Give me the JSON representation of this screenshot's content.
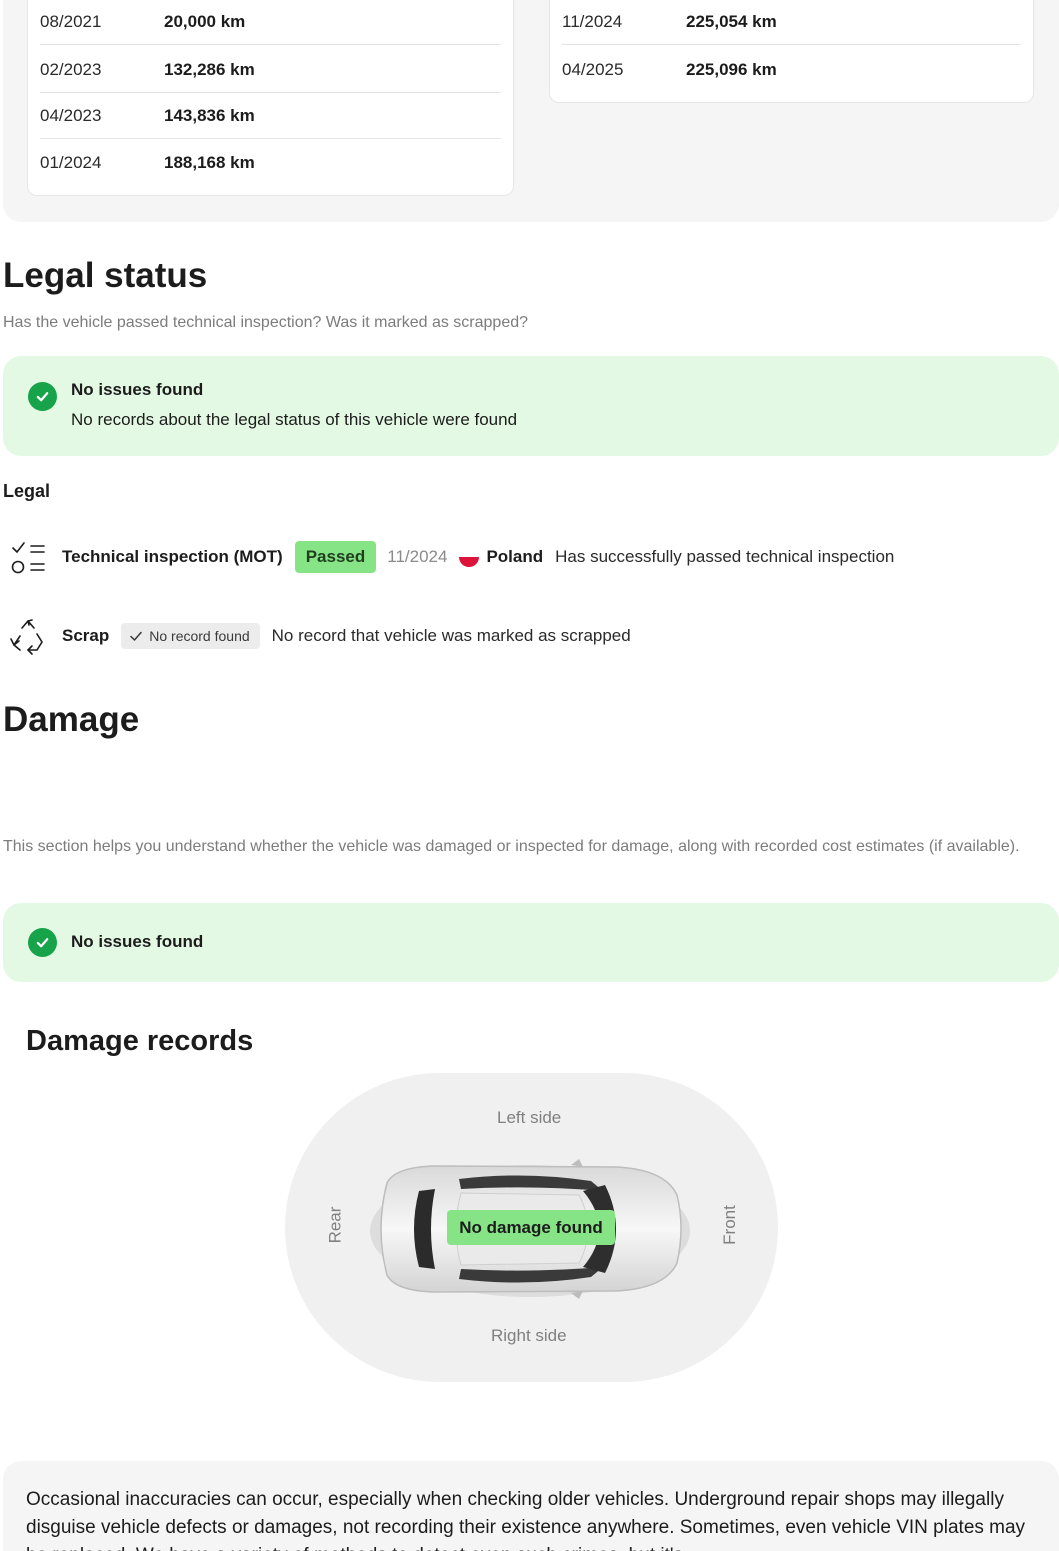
{
  "mileage": {
    "left_rows": [
      {
        "date": "08/2021",
        "km": "20,000 km"
      },
      {
        "date": "02/2023",
        "km": "132,286 km"
      },
      {
        "date": "04/2023",
        "km": "143,836 km"
      },
      {
        "date": "01/2024",
        "km": "188,168 km"
      }
    ],
    "right_rows": [
      {
        "date": "11/2024",
        "km": "225,054 km"
      },
      {
        "date": "04/2025",
        "km": "225,096 km"
      }
    ]
  },
  "legal_status": {
    "title": "Legal status",
    "subtitle": "Has the vehicle passed technical inspection? Was it marked as scrapped?",
    "summary": {
      "title": "No issues found",
      "text": "No records about the legal status of this vehicle were found"
    },
    "section_label": "Legal",
    "inspection": {
      "icon": "checklist-icon",
      "title": "Technical inspection (MOT)",
      "badge": "Passed",
      "date": "11/2024",
      "country": "Poland",
      "description": "Has successfully passed technical inspection"
    },
    "scrap": {
      "icon": "recycle-icon",
      "title": "Scrap",
      "badge": "No record found",
      "description": "No record that vehicle was marked as scrapped"
    }
  },
  "damage": {
    "title": "Damage",
    "subtitle": "This section helps you understand whether the vehicle was damaged or inspected for damage, along with recorded cost estimates (if available).",
    "summary": {
      "title": "No issues found"
    },
    "records_title": "Damage records",
    "diagram": {
      "left_side": "Left side",
      "right_side": "Right side",
      "rear": "Rear",
      "front": "Front",
      "status": "No damage found"
    }
  },
  "note": {
    "text": "Occasional inaccuracies can occur, especially when checking older vehicles. Underground repair shops may illegally disguise vehicle defects or damages, not recording their existence anywhere. Sometimes, even vehicle VIN plates may be replaced. We have a variety of methods to detect even such crimes, but it's"
  },
  "colors": {
    "success_bg": "#e3f9e3",
    "success_icon": "#16a34a",
    "badge_green": "#86e486",
    "panel_gray": "#f5f5f5"
  }
}
